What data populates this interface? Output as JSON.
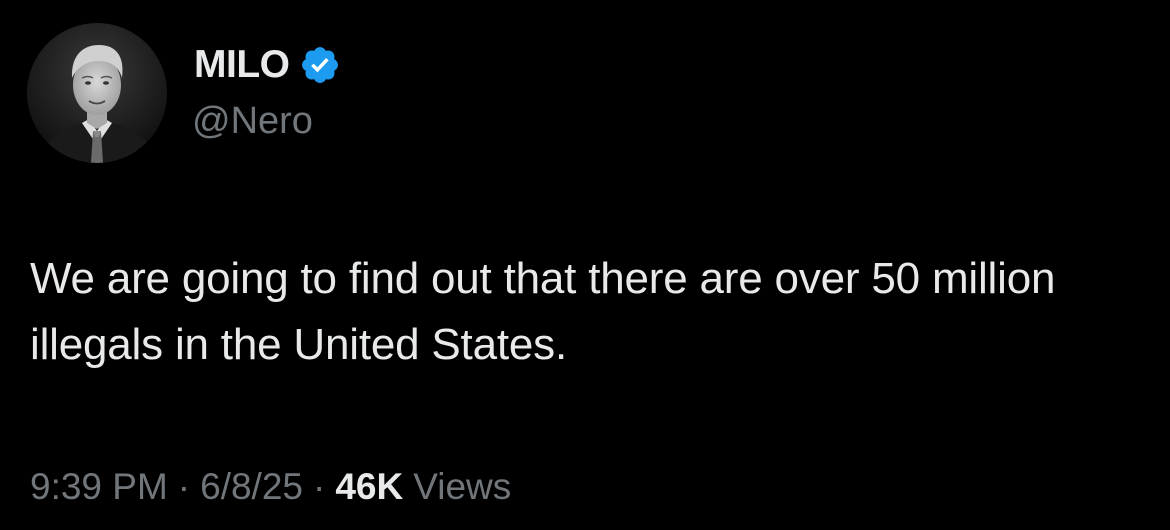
{
  "author": {
    "display_name": "MILO",
    "handle": "@Nero",
    "verified_icon": "verified-badge-icon",
    "verified_color": "#1d9bf0"
  },
  "tweet": {
    "text": "We are going to find out that there are over 50 million illegals in the United States."
  },
  "meta": {
    "time": "9:39 PM",
    "separator": "·",
    "date": "6/8/25",
    "views_count": "46K",
    "views_label": "Views"
  },
  "colors": {
    "background": "#000000",
    "primary_text": "#e7e9ea",
    "secondary_text": "#71767b"
  }
}
